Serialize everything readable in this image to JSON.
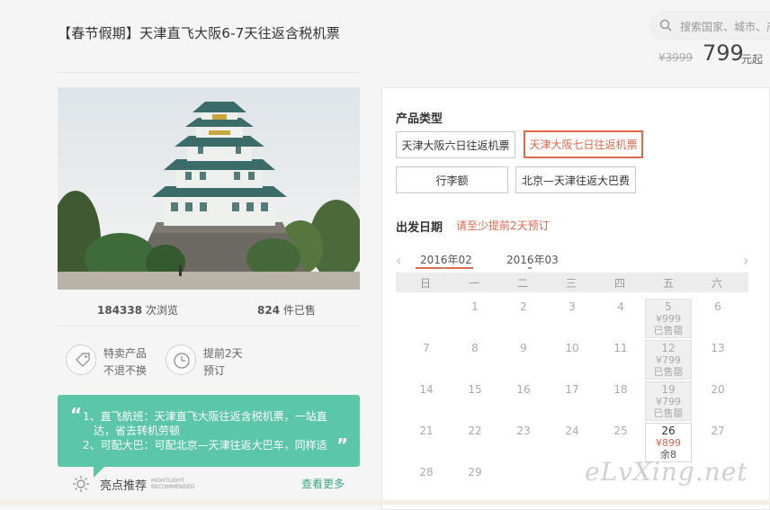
{
  "header": {
    "title": "【春节假期】天津直飞大阪6-7天往返含税机票",
    "search_placeholder": "搜索国家、城市、产",
    "old_price": "¥3999",
    "price": "799",
    "price_unit": "元起"
  },
  "stats": {
    "views_count": "184338",
    "views_label": "次浏览",
    "sold_count": "824",
    "sold_label": "件已售"
  },
  "features": [
    {
      "icon": "tag-icon",
      "line1": "特卖产品",
      "line2": "不退不换"
    },
    {
      "icon": "clock-icon",
      "line1": "提前2天",
      "line2": "预订"
    }
  ],
  "highlight": {
    "lines": [
      "1、直飞航班：天津直飞大阪往返含税机票，一站直",
      "达，省去转机劳顿",
      "2、可配大巴：可配北京—天津往返大巴车，同样适"
    ],
    "label": "亮点推荐",
    "label_en_1": "HIGHTLIGHT",
    "label_en_2": "RECOMMENDED",
    "see_more": "查看更多"
  },
  "product_type": {
    "label": "产品类型",
    "options": [
      {
        "label": "天津大阪六日往返机票",
        "selected": false
      },
      {
        "label": "天津大阪七日往返机票",
        "selected": true
      },
      {
        "label": "行李额",
        "selected": false
      },
      {
        "label": "北京—天津往返大巴费",
        "selected": false
      }
    ]
  },
  "departure": {
    "label": "出发日期",
    "note": "请至少提前2天预订",
    "months": [
      "2016年02",
      "2016年03"
    ],
    "active_month": "2016年02",
    "weekdays": [
      "日",
      "一",
      "二",
      "三",
      "四",
      "五",
      "六"
    ],
    "weeks": [
      [
        null,
        "1",
        "2",
        "3",
        "4",
        {
          "d": "5",
          "price": "¥999",
          "status": "已售罄"
        },
        "6"
      ],
      [
        "7",
        "8",
        "9",
        "10",
        "11",
        {
          "d": "12",
          "price": "¥799",
          "status": "已售罄"
        },
        "13"
      ],
      [
        "14",
        "15",
        "16",
        "17",
        "18",
        {
          "d": "19",
          "price": "¥799",
          "status": "已售罄"
        },
        "20"
      ],
      [
        "21",
        "22",
        "23",
        "24",
        "25",
        {
          "d": "26",
          "price": "¥899",
          "status": "余8",
          "active": true
        },
        "27"
      ],
      [
        "28",
        "29",
        null,
        null,
        null,
        null,
        null
      ]
    ]
  },
  "watermark": "eLvXing.net",
  "colors": {
    "accent": "#e0684d",
    "highlight_bg": "#5cc7a8",
    "see_more": "#3aa882"
  }
}
